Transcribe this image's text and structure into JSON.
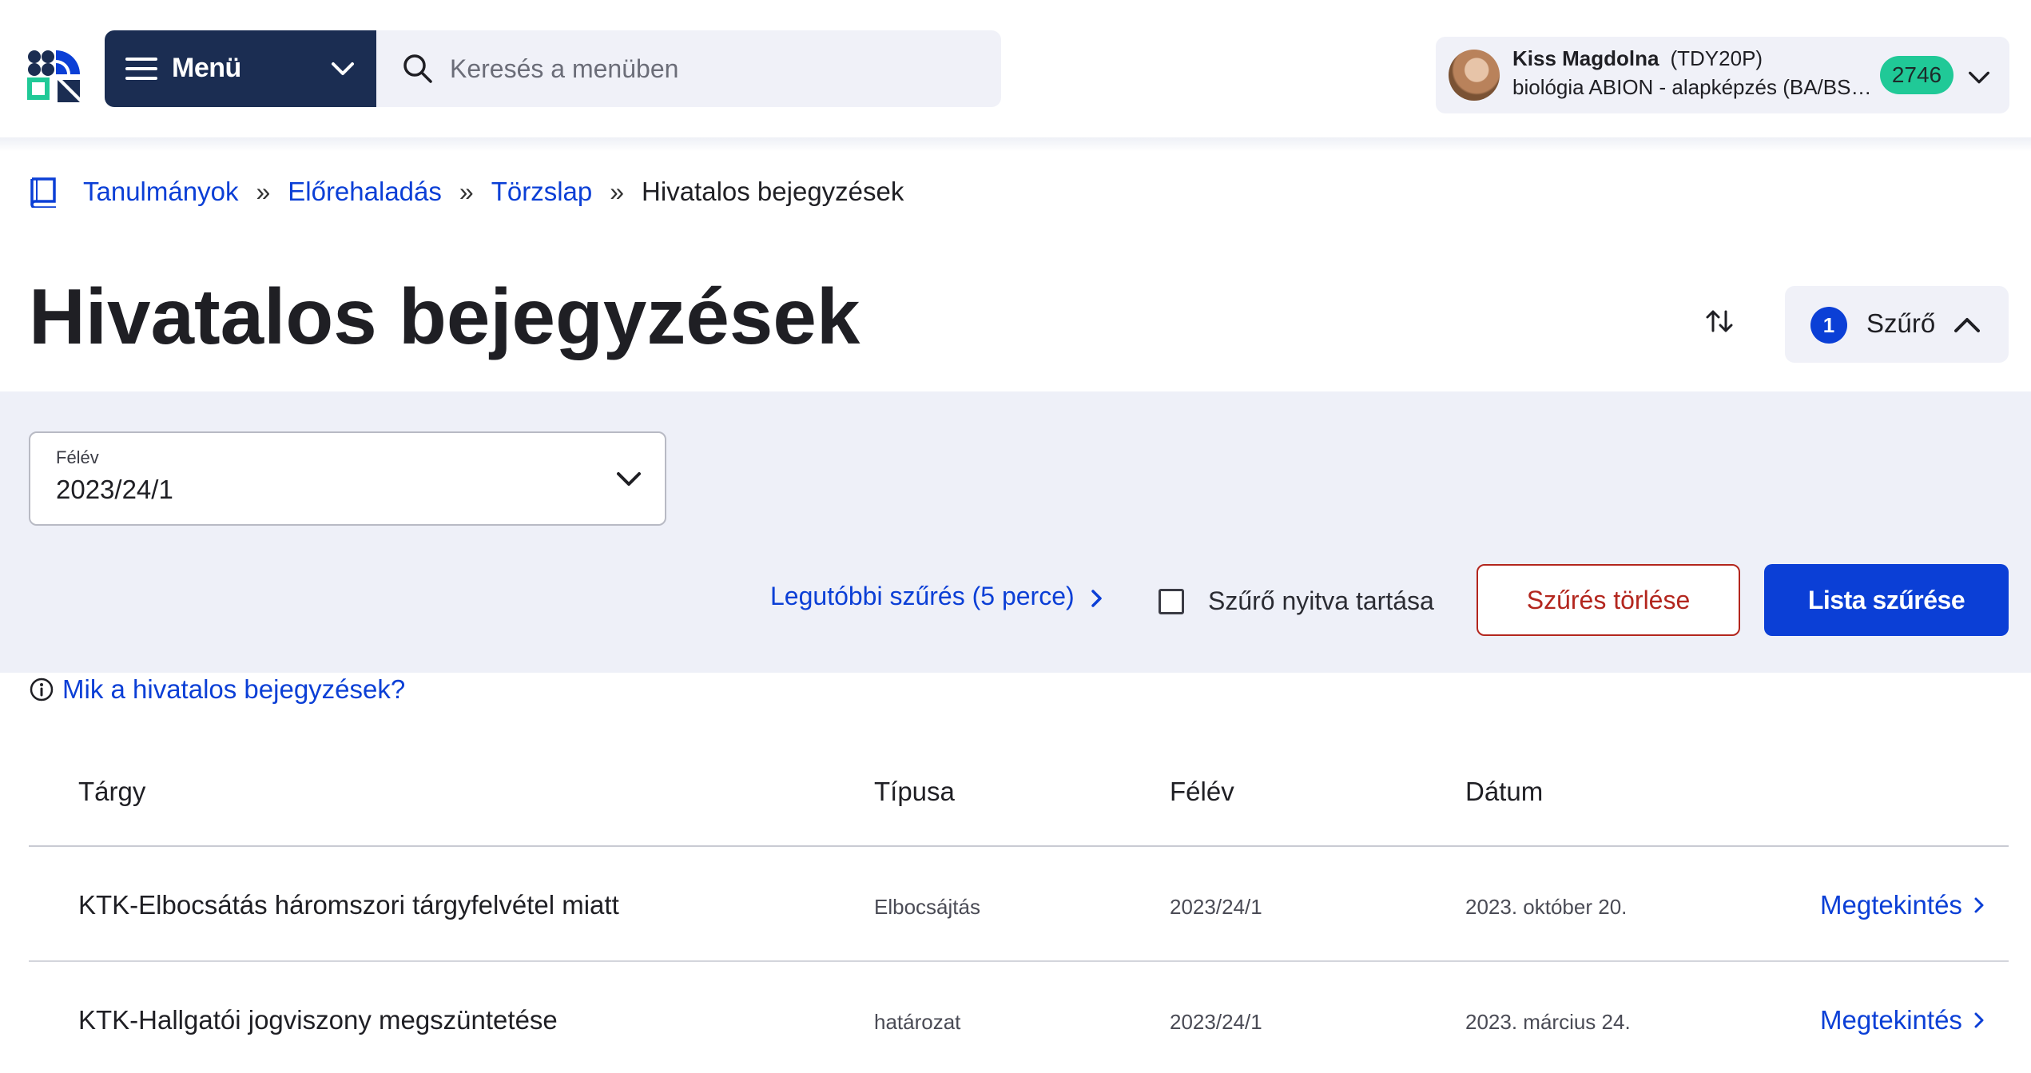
{
  "header": {
    "menu_label": "Menü",
    "search_placeholder": "Keresés a menüben",
    "user": {
      "name": "Kiss Magdolna",
      "code": "(TDY20P)",
      "program": "biológia ABION - alapképzés (BA/BSc/...",
      "badge": "2746"
    }
  },
  "breadcrumb": {
    "items": [
      "Tanulmányok",
      "Előrehaladás",
      "Törzslap"
    ],
    "separator": "»",
    "current": "Hivatalos bejegyzések"
  },
  "page": {
    "title": "Hivatalos bejegyzések",
    "filter_count": "1",
    "filter_label": "Szűrő"
  },
  "filter": {
    "semester_label": "Félév",
    "semester_value": "2023/24/1",
    "recent_filter": "Legutóbbi szűrés (5 perce)",
    "keep_open_label": "Szűrő nyitva tartása",
    "clear_button": "Szűrés törlése",
    "apply_button": "Lista szűrése"
  },
  "info_link": "Mik a hivatalos bejegyzések?",
  "table": {
    "headers": [
      "Tárgy",
      "Típusa",
      "Félév",
      "Dátum"
    ],
    "rows": [
      {
        "subject": "KTK-Elbocsátás háromszori tárgyfelvétel miatt",
        "type": "Elbocsájtás",
        "semester": "2023/24/1",
        "date": "2023. október 20.",
        "action": "Megtekintés"
      },
      {
        "subject": "KTK-Hallgatói jogviszony megszüntetése",
        "type": "határozat",
        "semester": "2023/24/1",
        "date": "2023. március 24.",
        "action": "Megtekintés"
      }
    ]
  },
  "colors": {
    "navy": "#1b2d52",
    "link_blue": "#0b3fd6",
    "badge_green": "#20c997",
    "danger_red": "#b3261e",
    "panel_bg": "#eef0f8"
  }
}
